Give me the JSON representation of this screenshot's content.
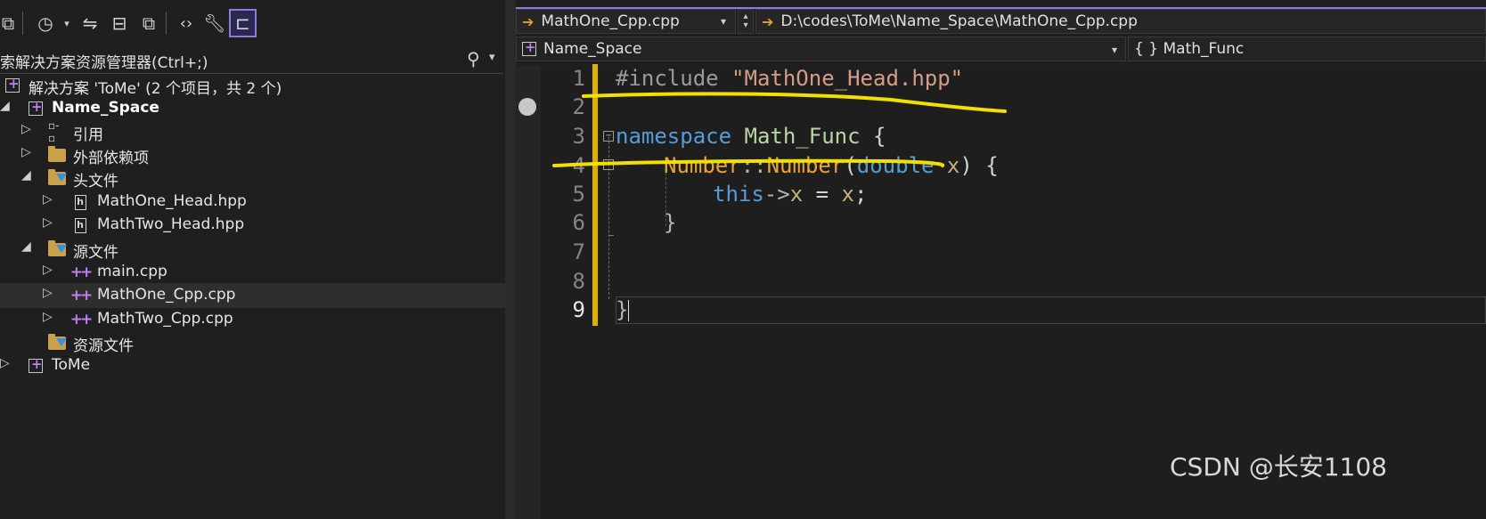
{
  "solution_explorer": {
    "search_placeholder": "搜索解决方案资源管理器(Ctrl+;)",
    "solution_label": "解决方案 'ToMe' (2 个项目，共 2 个)",
    "items": [
      {
        "label": "Name_Space",
        "bold": true
      },
      {
        "label": "引用"
      },
      {
        "label": "外部依赖项"
      },
      {
        "label": "头文件"
      },
      {
        "label": "MathOne_Head.hpp"
      },
      {
        "label": "MathTwo_Head.hpp"
      },
      {
        "label": "源文件"
      },
      {
        "label": "main.cpp"
      },
      {
        "label": "MathOne_Cpp.cpp",
        "selected": true
      },
      {
        "label": "MathTwo_Cpp.cpp"
      },
      {
        "label": "资源文件"
      },
      {
        "label": "ToMe"
      }
    ]
  },
  "editor": {
    "file_dropdown": "MathOne_Cpp.cpp",
    "file_path": "D:\\codes\\ToMe\\Name_Space\\MathOne_Cpp.cpp",
    "project_scope": "Name_Space",
    "member_scope": "{ } Math_Func",
    "line_numbers": [
      "1",
      "2",
      "3",
      "4",
      "5",
      "6",
      "7",
      "8",
      "9"
    ],
    "code": {
      "l1_directive": "#include",
      "l1_string": "\"MathOne_Head.hpp\"",
      "l3_keyword": "namespace",
      "l3_name": "Math_Func",
      "l3_brace": "{",
      "l4_type": "Number",
      "l4_scope": "::",
      "l4_ctor": "Number",
      "l4_open": "(",
      "l4_ptype": "double",
      "l4_pname": "x",
      "l4_close": ")",
      "l4_brace": "{",
      "l5_this": "this",
      "l5_arrow": "->",
      "l5_member": "x",
      "l5_rest": " = ",
      "l5_val": "x",
      "l5_semi": ";",
      "l6_brace": "}",
      "l9_brace": "}"
    }
  },
  "watermark": "CSDN @长安1108",
  "colors": {
    "accent": "#8a7be0",
    "annotation": "#f2e000"
  }
}
